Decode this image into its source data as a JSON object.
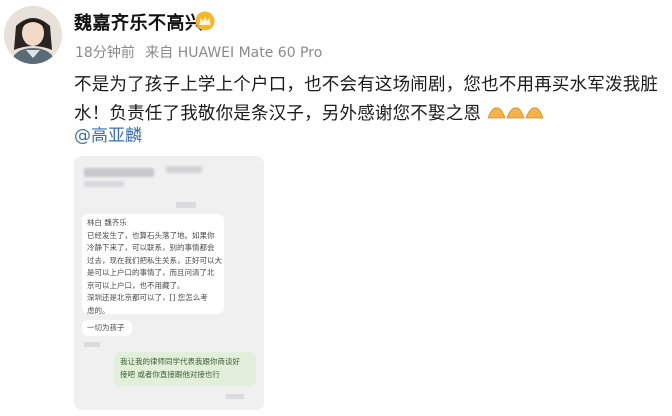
{
  "post": {
    "username": "魏嘉齐乐不高兴",
    "time": "18分钟前",
    "source": "来自 HUAWEI Mate 60 Pro",
    "text": "不是为了孩子上学上个户口，也不会有这场闹剧，您也不用再买水军泼我脏水！负责任了我敬你是条汉子，另外感谢您不娶之恩",
    "emoji": "handshake-emoji",
    "mention": "@高亚麟"
  },
  "screenshot": {
    "messages": [
      {
        "side": "left",
        "text": "林白 魏齐乐\n已经发生了，也算石头落了地。如果你\n冷静下来了，可以联系，别的事情都会\n过去，现在我们把私生关系，正好可以大\n是可以上户口的事情了，而且问清了北\n京可以上户口，也不用藏了。\n深圳还是北京都可以了，[] 您怎么考\n虑的。"
      },
      {
        "side": "left",
        "text": "一切为孩子"
      },
      {
        "side": "right",
        "text": "我让我的律师同学代表我跟你商谈好\n接吧 或者你直接跟他对接也行"
      }
    ]
  },
  "colors": {
    "mention": "#3c6fb6",
    "meta": "#8a8a8a",
    "bubble_green": "#e2f0db"
  }
}
